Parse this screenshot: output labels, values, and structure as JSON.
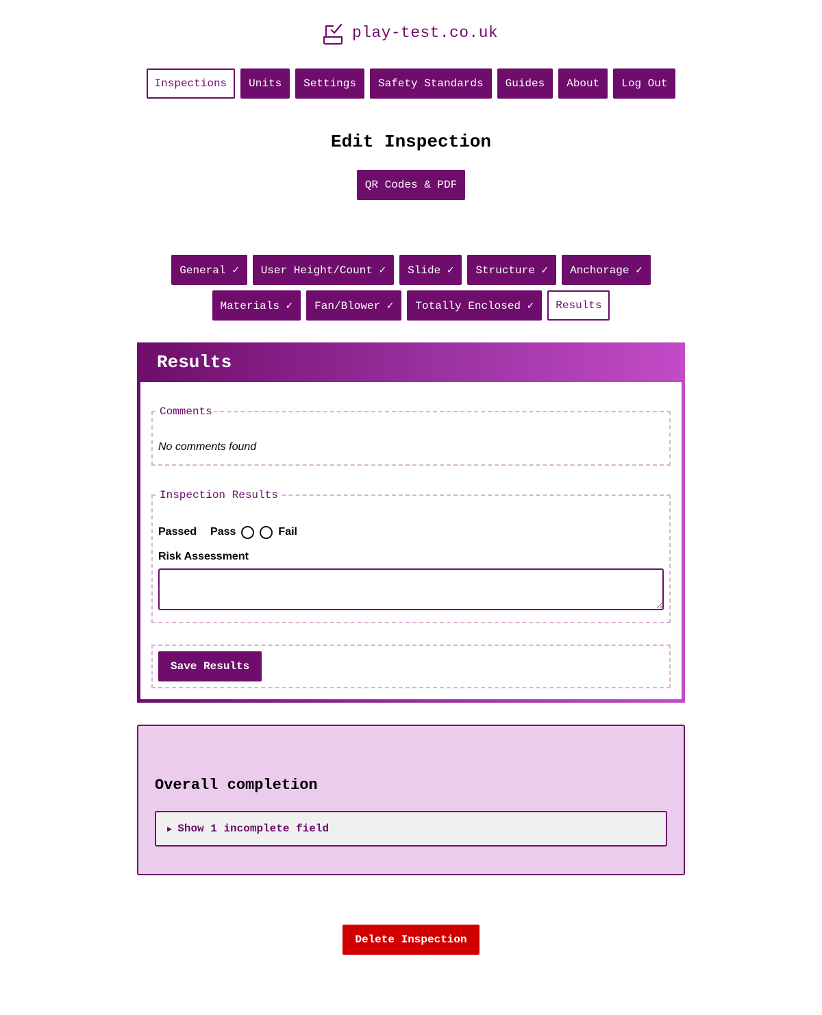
{
  "brand": {
    "name": "play-test.co.uk",
    "icon": "checkbox-tray-icon",
    "color": "#6e0d6b"
  },
  "nav": [
    {
      "label": "Inspections",
      "active": true
    },
    {
      "label": "Units"
    },
    {
      "label": "Settings"
    },
    {
      "label": "Safety Standards"
    },
    {
      "label": "Guides"
    },
    {
      "label": "About"
    },
    {
      "label": "Log Out"
    }
  ],
  "page": {
    "title": "Edit Inspection",
    "qr_button": "QR Codes & PDF"
  },
  "tabs": [
    {
      "label": "General ✓"
    },
    {
      "label": "User Height/Count ✓"
    },
    {
      "label": "Slide ✓"
    },
    {
      "label": "Structure ✓"
    },
    {
      "label": "Anchorage ✓"
    },
    {
      "label": "Materials ✓"
    },
    {
      "label": "Fan/Blower ✓"
    },
    {
      "label": "Totally Enclosed ✓"
    },
    {
      "label": "Results",
      "active": true
    }
  ],
  "results": {
    "title": "Results",
    "comments": {
      "legend": "Comments",
      "empty_text": "No comments found"
    },
    "inspection": {
      "legend": "Inspection Results",
      "passed_label": "Passed",
      "pass_label": "Pass",
      "fail_label": "Fail",
      "risk_label": "Risk Assessment",
      "risk_value": ""
    },
    "save_button": "Save Results"
  },
  "completion": {
    "title": "Overall completion",
    "summary": "Show 1 incomplete field"
  },
  "delete_button": "Delete Inspection",
  "colors": {
    "primary": "#6e0d6b",
    "danger": "#d10000",
    "panel_bg": "#ecccec"
  }
}
